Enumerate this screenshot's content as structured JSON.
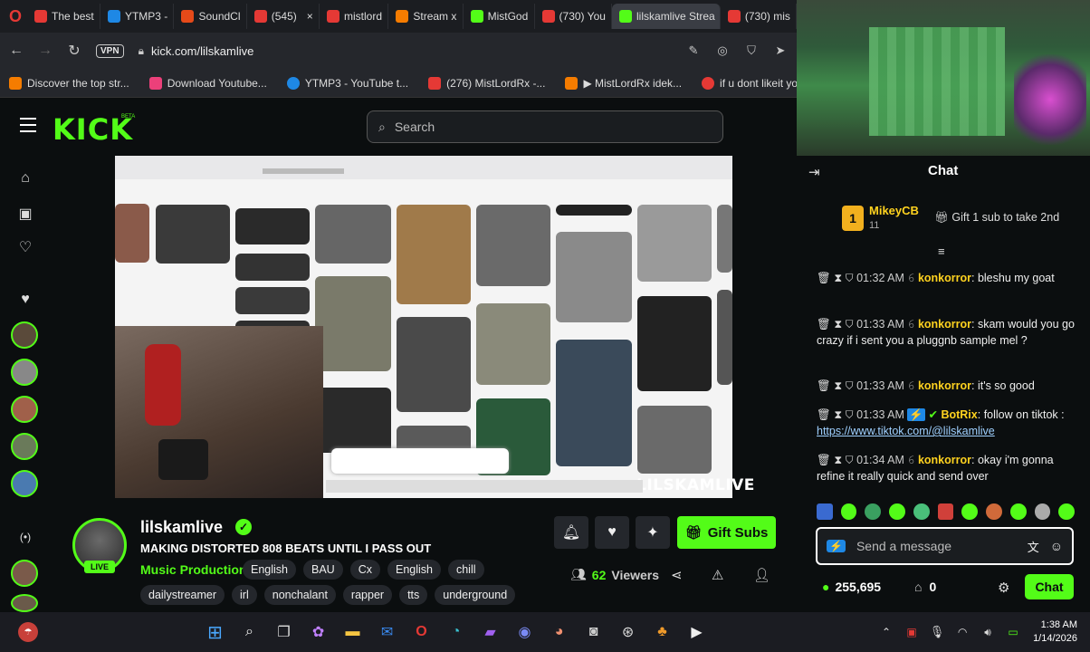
{
  "browser": {
    "tabs": [
      {
        "label": "The best",
        "color": "#e53935"
      },
      {
        "label": "YTMP3 -",
        "color": "#1e88e5"
      },
      {
        "label": "SoundCl",
        "color": "#e64a19"
      },
      {
        "label": "(545)",
        "color": "#e53935"
      },
      {
        "label": "mistlord",
        "color": "#e53935"
      },
      {
        "label": "Stream x",
        "color": "#f57c00"
      },
      {
        "label": "MistGod",
        "color": "#53fc18"
      },
      {
        "label": "(730) You",
        "color": "#e53935"
      },
      {
        "label": "lilskamlive Strea",
        "color": "#53fc18"
      },
      {
        "label": "(730) mis",
        "color": "#e53935"
      }
    ],
    "vpn_label": "VPN",
    "url": "kick.com/lilskamlive",
    "bookmarks": [
      {
        "label": "Discover the top str...",
        "color": "#f57c00"
      },
      {
        "label": "Download Youtube...",
        "color": "#ec407a"
      },
      {
        "label": "YTMP3 - YouTube t...",
        "color": "#1e88e5"
      },
      {
        "label": "(276) MistLordRx -...",
        "color": "#e53935"
      },
      {
        "label": "▶ MistLordRx idek...",
        "color": "#f57c00"
      },
      {
        "label": "if u dont likeit you b...",
        "color": "#e53935"
      }
    ]
  },
  "kick": {
    "logo": "KICK",
    "beta": "BETA",
    "search_placeholder": "Search"
  },
  "stream": {
    "watermark": "LILSKAMLIVE",
    "channel_name": "lilskamlive",
    "live_badge": "LIVE",
    "title": "MAKING DISTORTED 808 BEATS UNTIL I PASS OUT",
    "category": "Music Production",
    "tags_row1": [
      "English",
      "BAU",
      "Cx",
      "English",
      "chill"
    ],
    "tags_row2": [
      "dailystreamer",
      "irl",
      "nonchalant",
      "rapper",
      "tts",
      "underground"
    ],
    "viewers": "62",
    "viewers_label": "Viewers",
    "gift_subs": "Gift Subs"
  },
  "chat": {
    "title": "Chat",
    "pinned_user": "MikeyCB",
    "pinned_count": "11",
    "gift_text": "Gift 1 sub to take 2nd",
    "messages": [
      {
        "time": "01:32 AM",
        "user": "konkorror",
        "text": "bleshu my goat"
      },
      {
        "time": "01:33 AM",
        "user": "konkorror",
        "text": "skam would you go crazy if i sent you a pluggnb sample mel ?"
      },
      {
        "time": "01:33 AM",
        "user": "konkorror",
        "text": "it's so good"
      },
      {
        "time": "01:33 AM",
        "user": "BotRix",
        "text": "follow on tiktok :",
        "link": "https://www.tiktok.com/@lilskamlive"
      },
      {
        "time": "01:34 AM",
        "user": "konkorror",
        "text": "okay i'm gonna refine it really quick and send over"
      }
    ],
    "input_placeholder": "Send a message",
    "points": "255,695",
    "drops": "0",
    "send_label": "Chat"
  },
  "taskbar": {
    "time": "1:38 AM",
    "date": "1/14/2026"
  },
  "colors": {
    "accent": "#53fc18",
    "background": "#0b0e0f"
  }
}
